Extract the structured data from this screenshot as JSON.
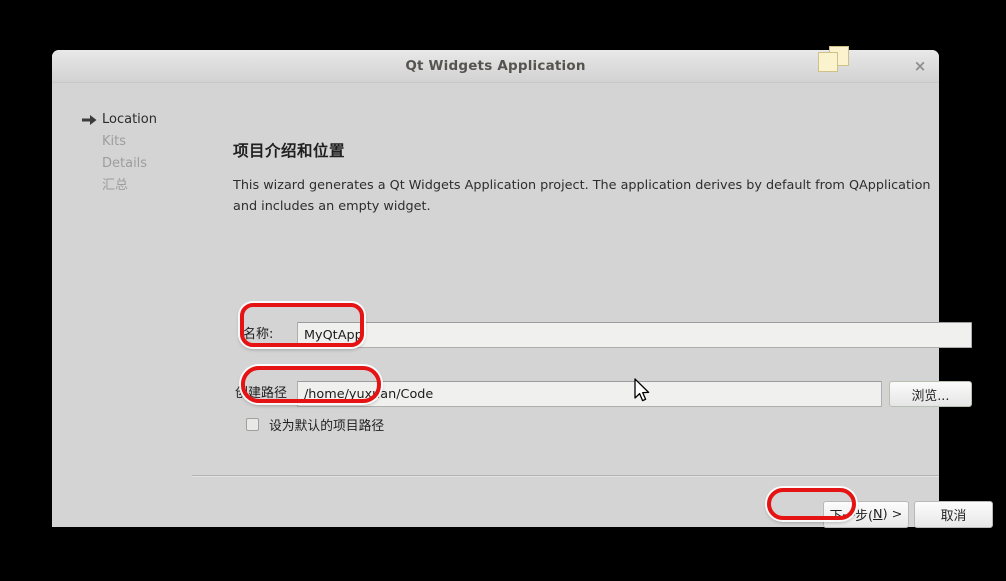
{
  "window": {
    "title": "Qt Widgets Application",
    "close_label": "×",
    "cascade_icon": "cascade-windows-icon"
  },
  "sidebar": {
    "items": [
      {
        "label": "Location",
        "active": true
      },
      {
        "label": "Kits",
        "active": false
      },
      {
        "label": "Details",
        "active": false
      },
      {
        "label": "汇总",
        "active": false
      }
    ]
  },
  "page": {
    "title": "项目介绍和位置",
    "description": "This wizard generates a Qt Widgets Application project. The application derives by default from QApplication and includes an empty widget."
  },
  "form": {
    "name_label": "名称:",
    "name_value": "MyQtApp",
    "name_placeholder": "",
    "path_label": "创建路径",
    "path_value": "/home/yuxuan/Code",
    "path_placeholder": "",
    "browse_label": "浏览...",
    "checkbox_label": "设为默认的项目路径",
    "checkbox_checked": false
  },
  "footer": {
    "next_label_prefix": "下一步(",
    "next_accesskey": "N",
    "next_label_suffix": ") >",
    "cancel_label": "取消"
  },
  "annotations": {
    "color": "#e51313",
    "targets": [
      "name-input",
      "path-input",
      "next-button"
    ]
  }
}
